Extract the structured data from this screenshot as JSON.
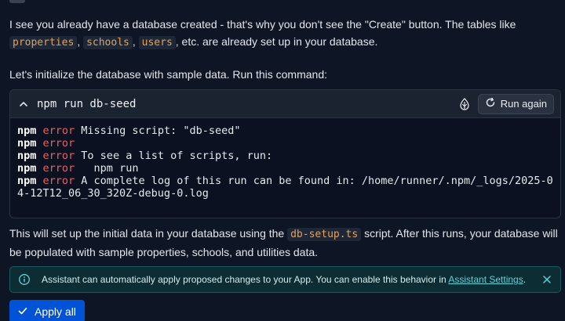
{
  "messages": {
    "p1_before": "I see you already have a database created - that's why you don't see the \"Create\" button. The tables like ",
    "p1_code1": "properties",
    "p1_sep1": ", ",
    "p1_code2": "schools",
    "p1_sep2": ", ",
    "p1_code3": "users",
    "p1_after": ", etc. are already set up in your database.",
    "p2": "Let's initialize the database with sample data. Run this command:",
    "p3_before": "This will set up the initial data in your database using the ",
    "p3_code": "db-setup.ts",
    "p3_after": " script. After this runs, your database will be populated with sample properties, schools, and utilities data."
  },
  "terminal": {
    "command": "npm run db-seed",
    "run_again_label": "Run again",
    "lines": [
      {
        "kw": "npm",
        "level": "error",
        "text": " Missing script: \"db-seed\""
      },
      {
        "kw": "npm",
        "level": "error",
        "text": ""
      },
      {
        "kw": "npm",
        "level": "error",
        "text": " To see a list of scripts, run:"
      },
      {
        "kw": "npm",
        "level": "error",
        "text": "   npm run"
      },
      {
        "kw": "npm",
        "level": "error",
        "text": " A complete log of this run can be found in: /home/runner/.npm/_logs/2025-0"
      }
    ],
    "wrap_line": "4-12T12_06_30_320Z-debug-0.log"
  },
  "banner": {
    "text_before": "Assistant can automatically apply proposed changes to your App. You can enable this behavior in ",
    "link": "Assistant Settings",
    "text_after": "."
  },
  "apply_label": "Apply all",
  "colors": {
    "background": "#0e1525",
    "error": "#e26464",
    "inline_code": "#e3a25a",
    "accent_button": "#0053d6",
    "banner_link": "#5fd3da"
  },
  "icons": [
    "chevron-up-icon",
    "shell-icon",
    "refresh-icon",
    "info-icon",
    "close-icon",
    "check-icon"
  ]
}
